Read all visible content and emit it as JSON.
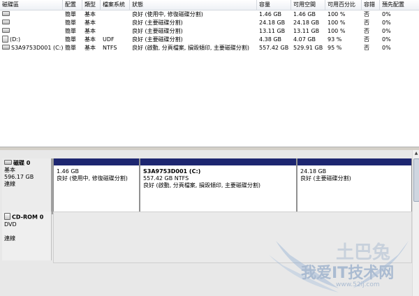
{
  "columns": [
    {
      "label": "磁碟區"
    },
    {
      "label": "配置"
    },
    {
      "label": "類型"
    },
    {
      "label": "檔案系統"
    },
    {
      "label": "狀態"
    },
    {
      "label": "容量"
    },
    {
      "label": "可用空間"
    },
    {
      "label": "可用百分比"
    },
    {
      "label": "容錯"
    },
    {
      "label": "預先配置"
    }
  ],
  "volumes": [
    {
      "icon": "drive-icon",
      "name": "",
      "layout": "簡單",
      "type": "基本",
      "fs": "",
      "status": "良好 (使用中, 修復磁碟分割)",
      "capacity": "1.46 GB",
      "free": "1.46 GB",
      "percent": "100 %",
      "fault": "否",
      "overhead": "0%"
    },
    {
      "icon": "drive-icon",
      "name": "",
      "layout": "簡單",
      "type": "基本",
      "fs": "",
      "status": "良好 (主要磁碟分割)",
      "capacity": "24.18 GB",
      "free": "24.18 GB",
      "percent": "100 %",
      "fault": "否",
      "overhead": "0%"
    },
    {
      "icon": "drive-icon",
      "name": "",
      "layout": "簡單",
      "type": "基本",
      "fs": "",
      "status": "良好 (主要磁碟分割)",
      "capacity": "13.11 GB",
      "free": "13.11 GB",
      "percent": "100 %",
      "fault": "否",
      "overhead": "0%"
    },
    {
      "icon": "cd-icon",
      "name": "(D:)",
      "layout": "簡單",
      "type": "基本",
      "fs": "UDF",
      "status": "良好 (主要磁碟分割)",
      "capacity": "4.38 GB",
      "free": "4.07 GB",
      "percent": "93 %",
      "fault": "否",
      "overhead": "0%"
    },
    {
      "icon": "drive-icon",
      "name": "S3A9753D001 (C:)",
      "layout": "簡單",
      "type": "基本",
      "fs": "NTFS",
      "status": "良好 (啟動, 分頁檔案, 損毀傾印, 主要磁碟分割)",
      "capacity": "557.42 GB",
      "free": "529.91 GB",
      "percent": "95 %",
      "fault": "否",
      "overhead": "0%"
    }
  ],
  "disk0": {
    "title": "磁碟 0",
    "type": "基本",
    "size": "596.17 GB",
    "state": "連線",
    "partitions": [
      {
        "name": "",
        "size": "1.46 GB",
        "status": "良好 (使用中, 修復磁碟分割)"
      },
      {
        "name": "S3A9753D001 (C:)",
        "size": "557.42 GB NTFS",
        "status": "良好 (啟動, 分頁檔案, 損毀傾印, 主要磁碟分割)"
      },
      {
        "name": "",
        "size": "24.18 GB",
        "status": "良好 (主要磁碟分割)"
      }
    ]
  },
  "cdrom0": {
    "title": "CD-ROM 0",
    "type": "DVD",
    "state": "連線"
  },
  "watermark": {
    "top": "土巴兔",
    "main": "我爱IT技术网",
    "url": "www.52ij.com"
  }
}
